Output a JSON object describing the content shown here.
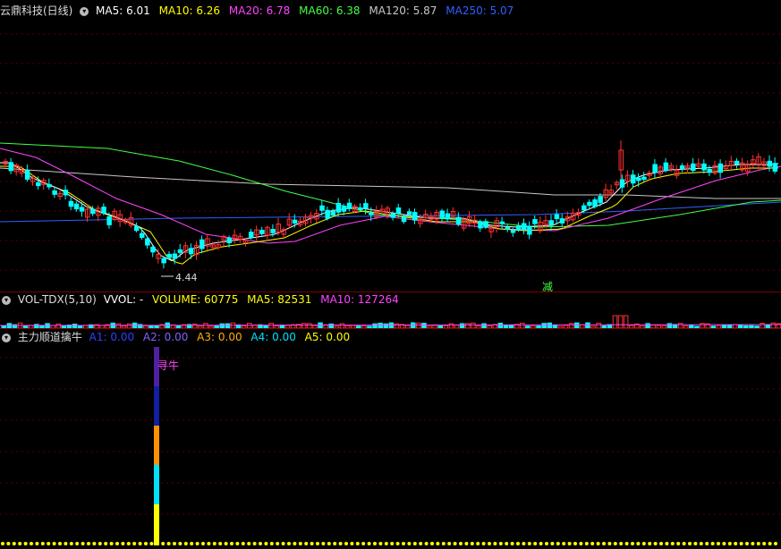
{
  "main": {
    "title": "云鼎科技(日线)",
    "ma": [
      {
        "label": "MA5: 6.01",
        "color": "#ffffff"
      },
      {
        "label": "MA10: 6.26",
        "color": "#ffff00"
      },
      {
        "label": "MA20: 6.78",
        "color": "#ff44ff"
      },
      {
        "label": "MA60: 6.38",
        "color": "#44ff44"
      },
      {
        "label": "MA120: 5.87",
        "color": "#c8c8c8"
      },
      {
        "label": "MA250: 5.07",
        "color": "#3060ff"
      }
    ],
    "low_label": "4.44",
    "signal_label": "减"
  },
  "vol": {
    "title": "VOL-TDX(5,10)",
    "items": [
      {
        "label": "VVOL: -",
        "color": "#ffffff"
      },
      {
        "label": "VOLUME: 60775",
        "color": "#ffff00"
      },
      {
        "label": "MA5: 82531",
        "color": "#ffff00"
      },
      {
        "label": "MA10: 127264",
        "color": "#ff44ff"
      }
    ]
  },
  "ind": {
    "title": "主力顺道擒牛",
    "items": [
      {
        "label": "A1: 0.00",
        "color": "#3040ff"
      },
      {
        "label": "A2: 0.00",
        "color": "#8060ff"
      },
      {
        "label": "A3: 0.00",
        "color": "#ffb000"
      },
      {
        "label": "A4: 0.00",
        "color": "#00e0ff"
      },
      {
        "label": "A5: 0.00",
        "color": "#ffff00"
      }
    ],
    "marker_label": "寻牛"
  },
  "colors": {
    "up": "#ff3030",
    "down": "#00ffff",
    "border": "#7a0000",
    "grid": "#5a0000"
  }
}
